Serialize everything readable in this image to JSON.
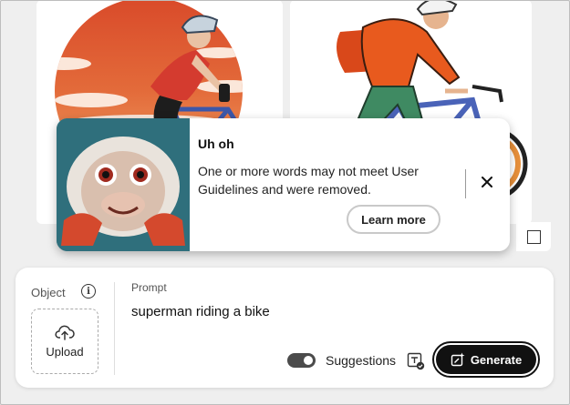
{
  "toast": {
    "title": "Uh oh",
    "message": "One or more words may not meet User Guidelines and were removed.",
    "learn_more": "Learn more"
  },
  "object": {
    "label": "Object",
    "upload_label": "Upload"
  },
  "prompt": {
    "label": "Prompt",
    "value": "superman riding a bike"
  },
  "suggestions": {
    "label": "Suggestions",
    "enabled": true
  },
  "generate": {
    "label": "Generate"
  },
  "colors": {
    "accent": "#111111",
    "sunset_orange": "#e0653a",
    "jacket_orange": "#e4541c",
    "pants_green": "#3f8a62"
  },
  "icons": [
    "info-icon",
    "upload-cloud-icon",
    "close-icon",
    "aspect-ratio-icon",
    "style-reference-icon",
    "generate-sparkle-icon"
  ]
}
